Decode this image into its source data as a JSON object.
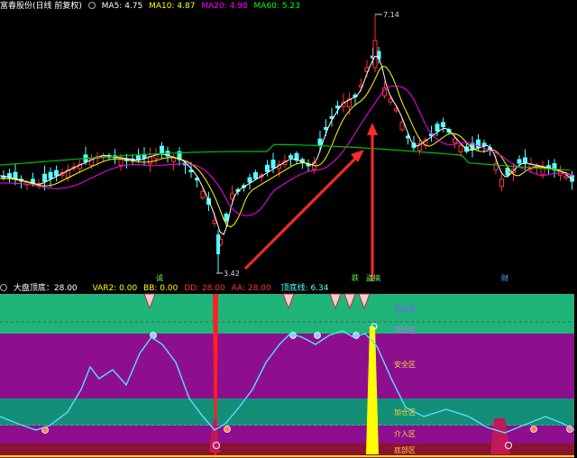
{
  "main_legend": {
    "title": "富春股份(日线 前复权)",
    "ma5": {
      "label": "MA5:",
      "value": "4.75",
      "color": "#ffffff"
    },
    "ma10": {
      "label": "MA10:",
      "value": "4.87",
      "color": "#ffff00"
    },
    "ma20": {
      "label": "MA20:",
      "value": "4.98",
      "color": "#ff00ff"
    },
    "ma60": {
      "label": "MA60:",
      "value": "5.23",
      "color": "#00ff00"
    }
  },
  "price_labels": {
    "high": "7.14",
    "low": "3.42"
  },
  "event_marks": {
    "m1": "诚",
    "m2": "跌",
    "m3": "盗搞",
    "m4": "财"
  },
  "indicator_legend": {
    "title": "大盘顶底：28.00",
    "var2": "VAR2: 0.00",
    "bb": "BB: 0.00",
    "dd": "DD: 28.00",
    "aa": "AA: 28.00",
    "line": "顶底线: 6.34"
  },
  "zones": {
    "sell": "卖出区",
    "risk": "风险区",
    "safe": "安全区",
    "add": "加仓区",
    "enter": "介入区",
    "bottom": "底部区"
  },
  "colors": {
    "up": "#ff3030",
    "down": "#54ffff",
    "top_band": "#1fb57a",
    "purple": "#8e0f8e",
    "teal": "#138f78",
    "dark_red": "#8a1232",
    "line": "#54e0ff"
  },
  "chart_data": {
    "type": "candlestick",
    "series_high_value": 7.14,
    "series_low_value": 3.42
  }
}
